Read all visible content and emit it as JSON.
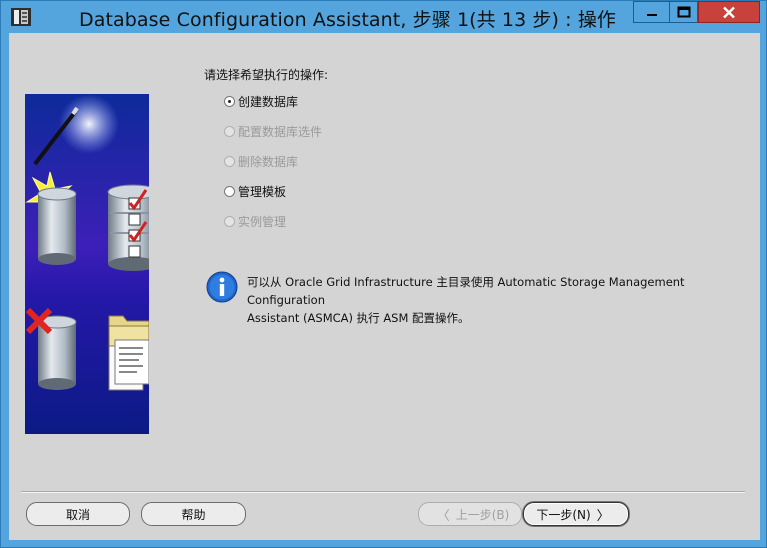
{
  "window": {
    "title": "Database Configuration Assistant, 步骤 1(共 13 步) : 操作"
  },
  "main": {
    "prompt": "请选择希望执行的操作:",
    "options": [
      {
        "label": "创建数据库",
        "selected": true,
        "enabled": true
      },
      {
        "label": "配置数据库选件",
        "selected": false,
        "enabled": false
      },
      {
        "label": "删除数据库",
        "selected": false,
        "enabled": false
      },
      {
        "label": "管理模板",
        "selected": false,
        "enabled": true
      },
      {
        "label": "实例管理",
        "selected": false,
        "enabled": false
      }
    ],
    "info_line1": "可以从 Oracle Grid Infrastructure 主目录使用 Automatic Storage Management Configuration",
    "info_line2": "Assistant (ASMCA) 执行 ASM 配置操作。"
  },
  "footer": {
    "cancel": "取消",
    "help": "帮助",
    "back": "上一步(B)",
    "next": "下一步(N)",
    "back_arrow": "〈",
    "next_arrow": "〉"
  },
  "colors": {
    "title_bar": "#54a5dd",
    "close_button": "#c8413a",
    "dialog_background": "#d4d4d4"
  }
}
